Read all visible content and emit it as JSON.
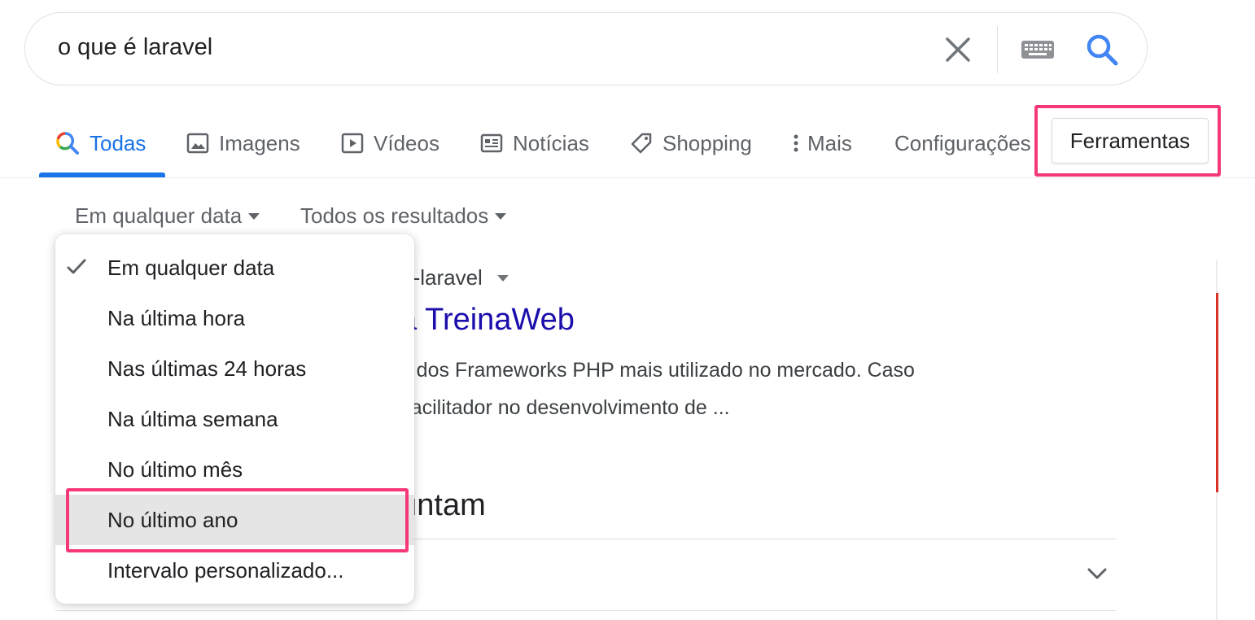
{
  "search": {
    "query": "o que é laravel"
  },
  "tabs": [
    {
      "label": "Todas",
      "icon": "search-multicolor-icon",
      "active": true
    },
    {
      "label": "Imagens",
      "icon": "image-icon"
    },
    {
      "label": "Vídeos",
      "icon": "play-icon"
    },
    {
      "label": "Notícias",
      "icon": "news-icon"
    },
    {
      "label": "Shopping",
      "icon": "tag-icon"
    },
    {
      "label": "Mais",
      "icon": "more-vertical-icon"
    },
    {
      "label": "Configurações"
    }
  ],
  "tools_button": "Ferramentas",
  "filters": {
    "date": "Em qualquer data",
    "results": "Todos os resultados"
  },
  "date_menu": {
    "items": [
      {
        "label": "Em qualquer data",
        "checked": true
      },
      {
        "label": "Na última hora"
      },
      {
        "label": "Nas últimas 24 horas"
      },
      {
        "label": "Na última semana"
      },
      {
        "label": "No último mês"
      },
      {
        "label": "No último ano",
        "hovered": true
      },
      {
        "label": "Intervalo personalizado..."
      }
    ]
  },
  "result": {
    "url_fragment": "e-e-laravel",
    "title_fragment": "da TreinaWeb",
    "snippet_line1": "um dos Frameworks PHP mais utilizado no mercado. Caso",
    "snippet_line2": "m facilitador no desenvolvimento de ..."
  },
  "people_also_ask": {
    "title_fragment": "guntam"
  },
  "colors": {
    "accent": "#1a73e8",
    "link": "#1a0dab",
    "highlight": "#f5387a",
    "hover_bg": "#e5e5e5"
  }
}
